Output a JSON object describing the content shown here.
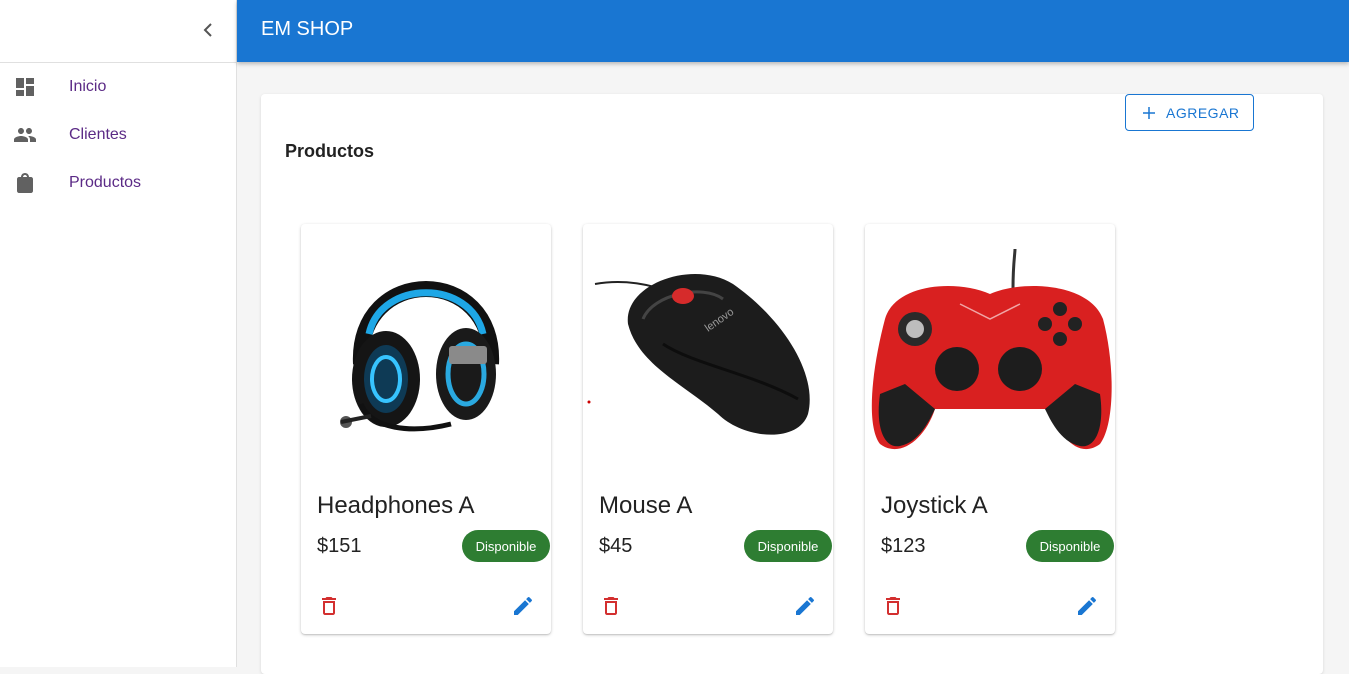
{
  "app": {
    "title": "EM SHOP"
  },
  "sidebar": {
    "items": [
      {
        "label": "Inicio",
        "icon": "dashboard-icon"
      },
      {
        "label": "Clientes",
        "icon": "people-icon"
      },
      {
        "label": "Productos",
        "icon": "shopping-bag-icon"
      }
    ]
  },
  "main": {
    "title": "Productos",
    "add_label": "AGREGAR"
  },
  "products": [
    {
      "name": "Headphones A",
      "price": "$151",
      "status": "Disponible",
      "image": "headphones-image"
    },
    {
      "name": "Mouse A",
      "price": "$45",
      "status": "Disponible",
      "image": "mouse-image"
    },
    {
      "name": "Joystick A",
      "price": "$123",
      "status": "Disponible",
      "image": "joystick-image"
    }
  ],
  "colors": {
    "primary": "#1976d2",
    "nav_text": "#5b2a86",
    "available": "#2e7d32",
    "delete": "#d32f2f"
  }
}
